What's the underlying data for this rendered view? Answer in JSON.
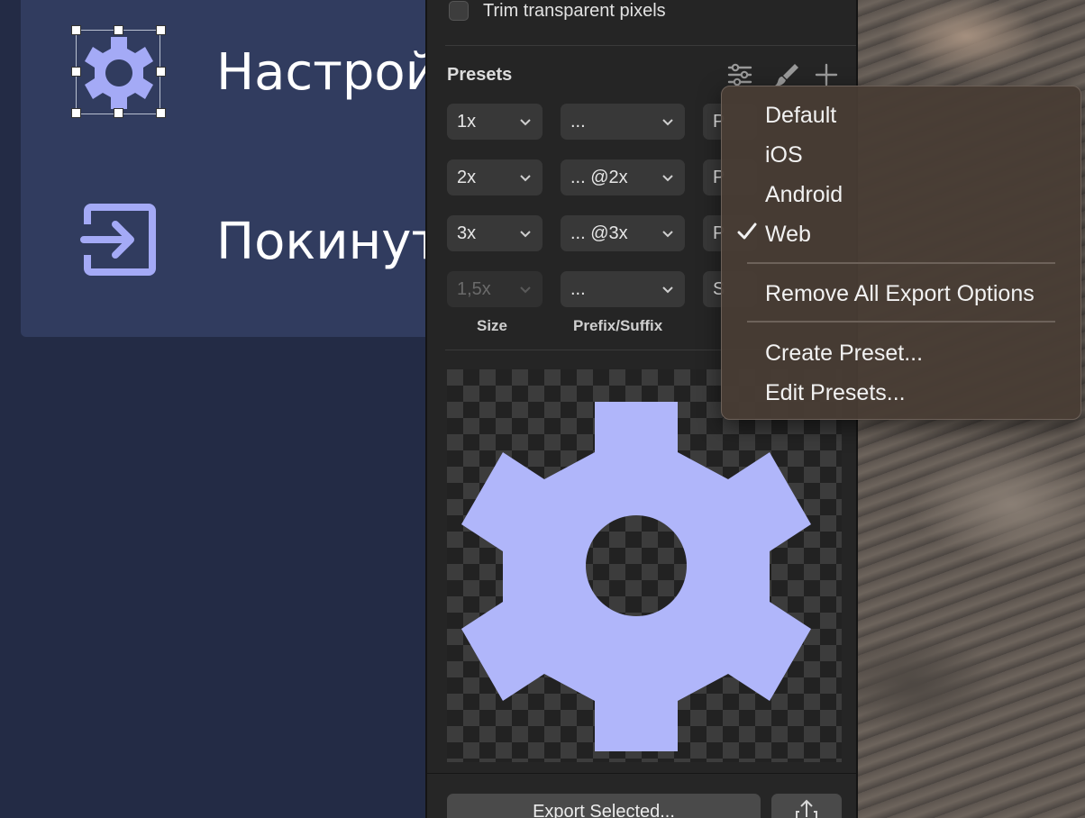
{
  "canvas": {
    "menu_items": [
      {
        "label": "Настройк",
        "icon": "gear-icon"
      },
      {
        "label": "Покинуть",
        "icon": "exit-icon"
      }
    ],
    "icon_color": "#a4aaf6",
    "artboard_color": "#313c5f"
  },
  "export_panel": {
    "trim_label": "Trim transparent pixels",
    "trim_checked": false,
    "presets_title": "Presets",
    "toolbar_icons": [
      "sliders-icon",
      "brush-icon",
      "plus-icon"
    ],
    "rows": [
      {
        "size": "1x",
        "prefix": "...",
        "format": "P"
      },
      {
        "size": "2x",
        "prefix": "... @2x",
        "format": "P"
      },
      {
        "size": "3x",
        "prefix": "... @3x",
        "format": "P"
      },
      {
        "size": "1,5x",
        "prefix": "...",
        "format": "S"
      }
    ],
    "column_labels": {
      "size": "Size",
      "prefix": "Prefix/Suffix"
    },
    "export_button": "Export Selected...",
    "share_icon": "share-icon"
  },
  "dropdown": {
    "items": [
      "Default",
      "iOS",
      "Android",
      "Web"
    ],
    "checked": "Web",
    "remove_all": "Remove All Export Options",
    "create_preset": "Create Preset...",
    "edit_presets": "Edit Presets..."
  }
}
